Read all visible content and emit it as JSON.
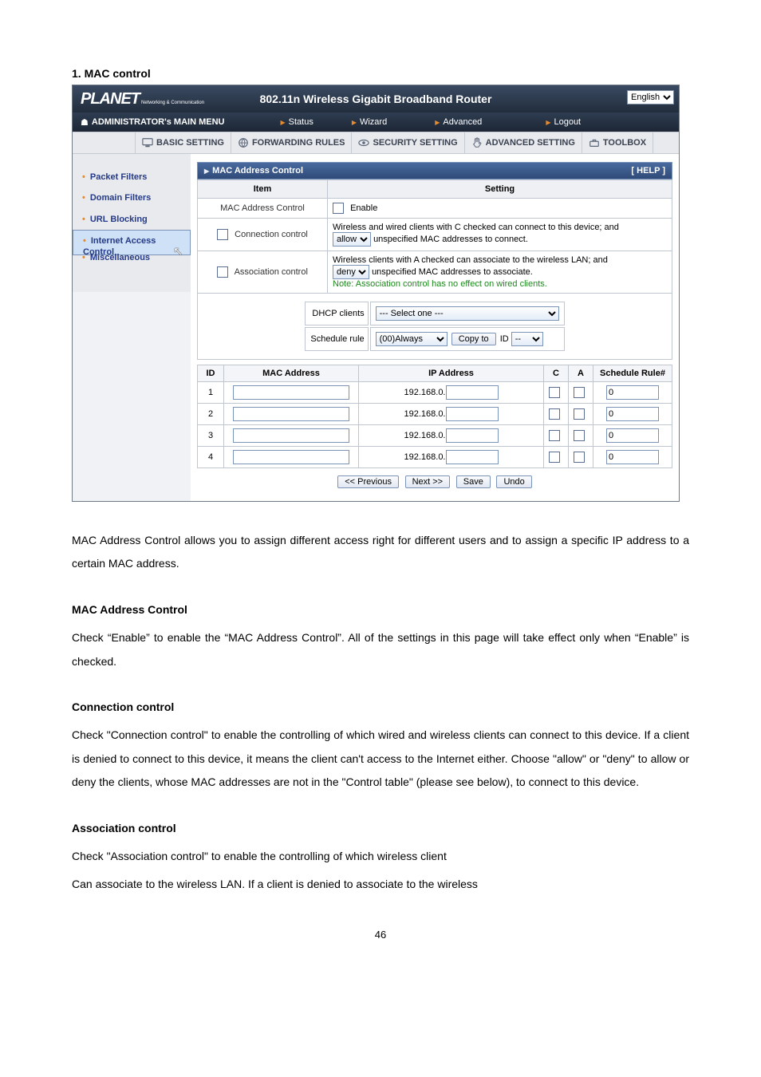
{
  "section_heading": "1.   MAC control",
  "header": {
    "logo": "PLANET",
    "logo_sub": "Networking & Communication",
    "title": "802.11n Wireless Gigabit Broadband Router",
    "language": "English"
  },
  "menu": {
    "lead": "ADMINISTRATOR's MAIN MENU",
    "status": "Status",
    "wizard": "Wizard",
    "advanced": "Advanced",
    "logout": "Logout"
  },
  "tabs": {
    "basic": "BASIC SETTING",
    "forwarding": "FORWARDING RULES",
    "security": "SECURITY SETTING",
    "advanced": "ADVANCED SETTING",
    "toolbox": "TOOLBOX"
  },
  "sidebar": {
    "packet": "Packet Filters",
    "domain": "Domain Filters",
    "url": "URL Blocking",
    "iac": "Internet Access Control",
    "misc": "Miscellaneous"
  },
  "panel": {
    "title": "MAC Address Control",
    "help": "[ HELP ]",
    "th_item": "Item",
    "th_setting": "Setting",
    "rows": {
      "mac_label": "MAC Address Control",
      "mac_setting": "Enable",
      "conn_label": "Connection control",
      "conn_text_a": "Wireless and wired clients with C checked can connect to this device; and",
      "conn_select": "allow",
      "conn_text_b": "unspecified MAC addresses to connect.",
      "assoc_label": "Association control",
      "assoc_text_a": "Wireless clients with A checked can associate to the wireless LAN; and",
      "assoc_select": "deny",
      "assoc_text_b": "unspecified MAC addresses to associate.",
      "assoc_note": "Note: Association control has no effect on wired clients."
    },
    "mid": {
      "dhcp_label": "DHCP clients",
      "dhcp_value": "--- Select one ---",
      "sched_label": "Schedule rule",
      "sched_value": "(00)Always",
      "copy_label": "Copy to",
      "id_label": "ID",
      "id_value": "--"
    },
    "grid": {
      "h_id": "ID",
      "h_mac": "MAC Address",
      "h_ip": "IP Address",
      "h_c": "C",
      "h_a": "A",
      "h_sr": "Schedule Rule#",
      "ip_prefix": "192.168.0.",
      "rows": [
        {
          "id": "1",
          "sr": "0"
        },
        {
          "id": "2",
          "sr": "0"
        },
        {
          "id": "3",
          "sr": "0"
        },
        {
          "id": "4",
          "sr": "0"
        }
      ]
    },
    "buttons": {
      "prev": "<< Previous",
      "next": "Next >>",
      "save": "Save",
      "undo": "Undo"
    }
  },
  "doc": {
    "p1": "MAC Address Control allows you to assign different access right for different users and to assign a specific IP address to a certain MAC address.",
    "h1": "MAC Address Control",
    "p2": "Check “Enable” to enable the “MAC Address Control”. All of the settings in this page will take effect only when “Enable” is checked.",
    "h2": "Connection control",
    "p3": "Check \"Connection control\" to enable the controlling of which wired and wireless clients can connect to this device. If a client is denied to connect to this device, it means the client can't access to the Internet either. Choose \"allow\" or \"deny\" to allow or deny the clients, whose MAC addresses are not in the \"Control table\" (please see below), to connect to this device.",
    "h3": "Association control",
    "p4": "Check \"Association control\" to enable the controlling of which wireless client",
    "p5": "Can associate to the wireless LAN. If a client is denied to associate to the wireless"
  },
  "page_number": "46"
}
